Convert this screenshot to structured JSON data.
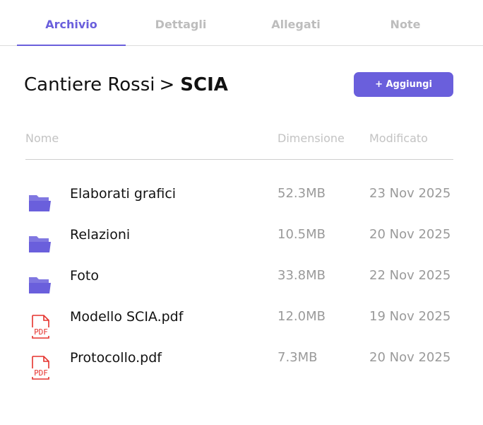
{
  "tabs": [
    {
      "label": "Archivio",
      "active": true
    },
    {
      "label": "Dettagli",
      "active": false
    },
    {
      "label": "Allegati",
      "active": false
    },
    {
      "label": "Note",
      "active": false
    }
  ],
  "breadcrumb": {
    "parent": "Cantiere Rossi",
    "separator": ">",
    "current": "SCIA"
  },
  "add_button": {
    "label": "+ Aggiungi"
  },
  "table": {
    "columns": {
      "name": "Nome",
      "size": "Dimensione",
      "modified": "Modificato"
    },
    "rows": [
      {
        "icon": "folder-icon",
        "name": "Elaborati grafici",
        "size": "52.3MB",
        "modified": "23 Nov 2025"
      },
      {
        "icon": "folder-icon",
        "name": "Relazioni",
        "size": "10.5MB",
        "modified": "20 Nov 2025"
      },
      {
        "icon": "folder-icon",
        "name": "Foto",
        "size": "33.8MB",
        "modified": "22 Nov 2025"
      },
      {
        "icon": "pdf-file-icon",
        "name": "Modello SCIA.pdf",
        "size": "12.0MB",
        "modified": "19 Nov 2025"
      },
      {
        "icon": "pdf-file-icon",
        "name": "Protocollo.pdf",
        "size": "7.3MB",
        "modified": "20 Nov 2025"
      }
    ]
  },
  "colors": {
    "accent": "#6a5fdc",
    "folder": "#6a5fdc",
    "pdf": "#e5322d",
    "muted": "#9a9a9a"
  },
  "icon_text": {
    "pdf": "PDF"
  }
}
